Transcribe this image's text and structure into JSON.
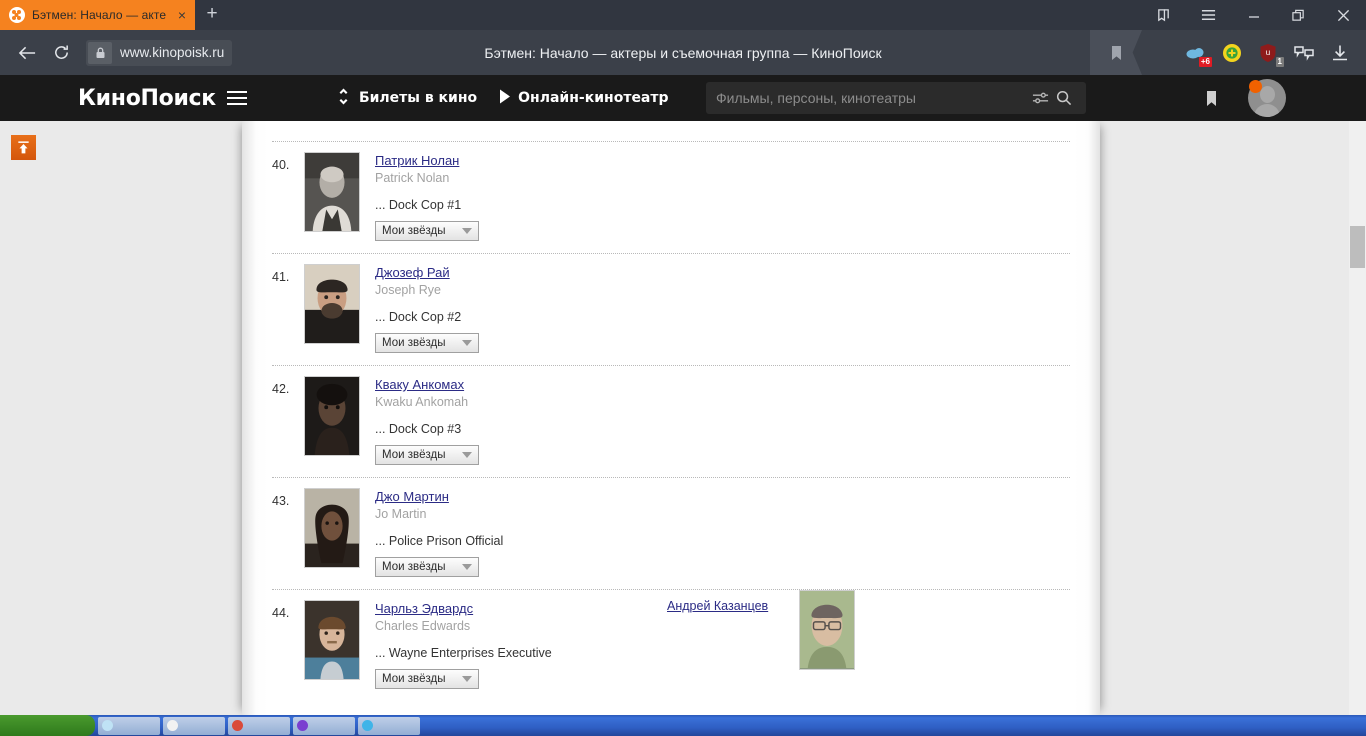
{
  "browser": {
    "tab": {
      "title": "Бэтмен: Начало — акте",
      "favicon": "film-reel-icon",
      "close": "×"
    },
    "newtab_label": "+",
    "window_controls": [
      "collections-icon",
      "menu-icon",
      "minimize-icon",
      "restore-icon",
      "close-icon"
    ],
    "toolbar": {
      "back_icon": "back-arrow-icon",
      "reload_icon": "reload-icon",
      "lock_icon": "padlock-icon",
      "url": "www.kinopoisk.ru",
      "page_title": "Бэтмен: Начало — актеры и съемочная группа — КиноПоиск",
      "bookmark_icon": "bookmark-flag-icon",
      "extensions": [
        {
          "name": "cloud-sync-icon",
          "badge": "+6",
          "badge_color": "#e01b24"
        },
        {
          "name": "shield-plus-icon",
          "badge": "",
          "badge_color": "#f0c000"
        },
        {
          "name": "adblock-icon",
          "badge": "1",
          "badge_color": "#7a7a7a"
        },
        {
          "name": "tab-manager-icon",
          "badge": "",
          "badge_color": ""
        },
        {
          "name": "download-icon",
          "badge": "",
          "badge_color": ""
        }
      ]
    }
  },
  "site_header": {
    "logo_bold": "Кино",
    "logo_rest": "Поиск",
    "menu_icon": "hamburger-menu-icon",
    "nav": [
      {
        "icon": "ticket-diamond-icon",
        "label": "Билеты в кино"
      },
      {
        "icon": "play-triangle-icon",
        "label": "Онлайн-кинотеатр"
      }
    ],
    "search": {
      "placeholder": "Фильмы, персоны, кинотеатры",
      "filter_icon": "sliders-icon",
      "search_icon": "magnifier-icon"
    },
    "bookmark_icon": "bookmark-icon",
    "avatar": "user-avatar",
    "notification_dot_color": "#f06100"
  },
  "page": {
    "scroll_top_button": "scroll-to-top-icon",
    "accent_color": "#f5821f",
    "link_color": "#2b2b85",
    "select_label": "Мои звёзды",
    "cast": [
      {
        "num": "40.",
        "name_ru": "Патрик Нолан",
        "name_en": "Patrick Nolan",
        "role": "... Dock Cop #1",
        "photo_tone": "#6f6f6f",
        "dub_name": "",
        "has_dub": false
      },
      {
        "num": "41.",
        "name_ru": "Джозеф Рай",
        "name_en": "Joseph Rye",
        "role": "... Dock Cop #2",
        "photo_tone": "#5a4d44",
        "dub_name": "",
        "has_dub": false
      },
      {
        "num": "42.",
        "name_ru": "Кваку Анкомах",
        "name_en": "Kwaku Ankomah",
        "role": "... Dock Cop #3",
        "photo_tone": "#3a2f35",
        "dub_name": "",
        "has_dub": false
      },
      {
        "num": "43.",
        "name_ru": "Джо Мартин",
        "name_en": "Jo Martin",
        "role": "... Police Prison Official",
        "photo_tone": "#5b4a40",
        "dub_name": "",
        "has_dub": false
      },
      {
        "num": "44.",
        "name_ru": "Чарльз Эдвардс",
        "name_en": "Charles Edwards",
        "role": "... Wayne Enterprises Executive",
        "photo_tone": "#4d5a63",
        "dub_name": "Андрей Казанцев",
        "has_dub": true
      }
    ]
  },
  "taskbar": {
    "start_label": "",
    "buttons": [
      "#bfe2f5",
      "#e8d49a",
      "#f2f2f2",
      "#d94a3a",
      "#7a3fd0",
      "#3fb4e8"
    ]
  }
}
